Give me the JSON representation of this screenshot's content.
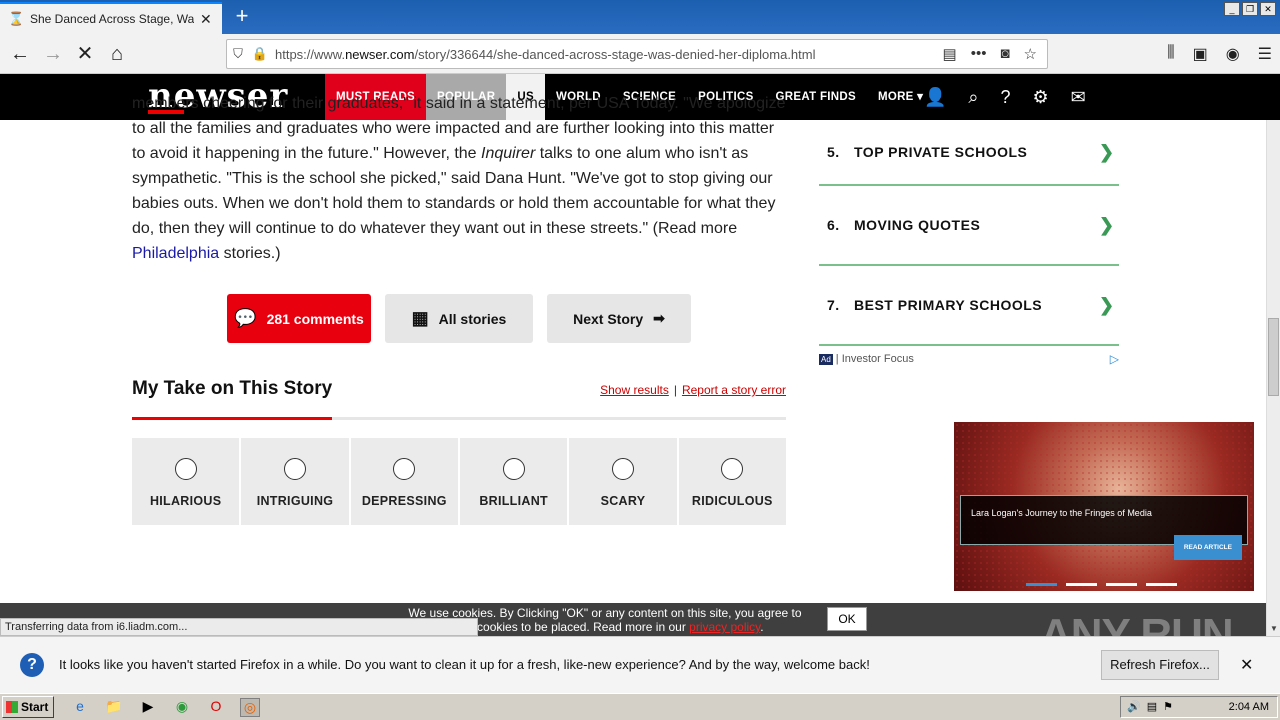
{
  "browser": {
    "tab_title": "She Danced Across Stage, Was Denied Her Diploma",
    "url_prefix": "https://www.",
    "url_domain": "newser.com",
    "url_path": "/story/336644/she-danced-across-stage-was-denied-her-diploma.html",
    "new_tab_glyph": "+"
  },
  "site": {
    "logo": "newser",
    "nav": [
      "MUST READS",
      "POPULAR",
      "US",
      "WORLD",
      "SCIENCE",
      "POLITICS",
      "GREAT FINDS",
      "MORE ▾"
    ]
  },
  "article": {
    "line0": "members cheering for their graduates,\" it said in a statement, per USA Today. \"We apologize",
    "line1": "to all the families and graduates who were impacted and are further looking into this matter",
    "line2a": "to avoid it happening in the future.\" However, the ",
    "line2_em": "Inquirer",
    "line2b": " talks to one alum who isn't as",
    "line3": "sympathetic. \"This is the school she picked,\" said Dana Hunt. \"We've got to stop giving our",
    "line4": "babies outs. When we don't hold them to standards or hold them accountable for what they",
    "line5": "do, then they will continue to do whatever they want out in these streets.\" (Read more",
    "link_philly": "Philadelphia",
    "line6_tail": " stories.)"
  },
  "buttons": {
    "comments": "281 comments",
    "all_stories": "All stories",
    "next_story": "Next Story"
  },
  "mytake": {
    "title": "My Take on This Story",
    "show_results": "Show results",
    "report": "Report a story error",
    "options": [
      "HILARIOUS",
      "INTRIGUING",
      "DEPRESSING",
      "BRILLIANT",
      "SCARY",
      "RIDICULOUS"
    ]
  },
  "sidebar": {
    "items": [
      {
        "num": "5.",
        "label": "TOP PRIVATE SCHOOLS"
      },
      {
        "num": "6.",
        "label": "MOVING QUOTES"
      },
      {
        "num": "7.",
        "label": "BEST PRIMARY SCHOOLS"
      }
    ],
    "ad_badge": "Ad",
    "ad_source": "| Investor Focus"
  },
  "video_ad": {
    "caption": "Lara Logan's Journey to the Fringes of Media",
    "cta": "READ ARTICLE"
  },
  "cookie": {
    "text_a": "We use cookies. By Clicking \"OK\" or any content on this site, you agree to",
    "text_b": "allow cookies to be placed. Read more in our ",
    "link": "privacy policy",
    "text_c": ".",
    "ok": "OK"
  },
  "status_text": "Transferring data from i6.liadm.com...",
  "watermark": "ANY RUN",
  "notification": {
    "message": "It looks like you haven't started Firefox in a while. Do you want to clean it up for a fresh, like-new experience? And by the way, welcome back!",
    "refresh": "Refresh Firefox...",
    "close": "✕"
  },
  "taskbar": {
    "start": "Start",
    "clock": "2:04 AM"
  }
}
